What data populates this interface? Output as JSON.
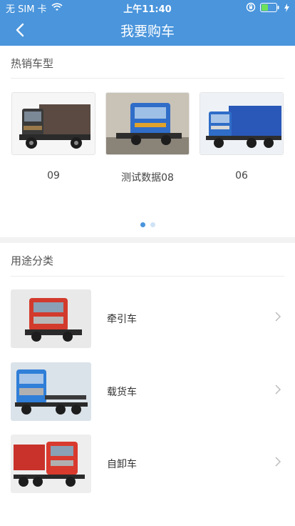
{
  "status": {
    "carrier": "无 SIM 卡",
    "time": "上午11:40"
  },
  "nav": {
    "title": "我要购车"
  },
  "hot": {
    "title": "热销车型",
    "items": [
      {
        "label": "09"
      },
      {
        "label": "测试数据08"
      },
      {
        "label": "06"
      }
    ],
    "pages": 2,
    "active_page": 1
  },
  "category": {
    "title": "用途分类",
    "items": [
      {
        "label": "牵引车"
      },
      {
        "label": "载货车"
      },
      {
        "label": "自卸车"
      }
    ]
  },
  "colors": {
    "brand": "#4a95dc"
  }
}
